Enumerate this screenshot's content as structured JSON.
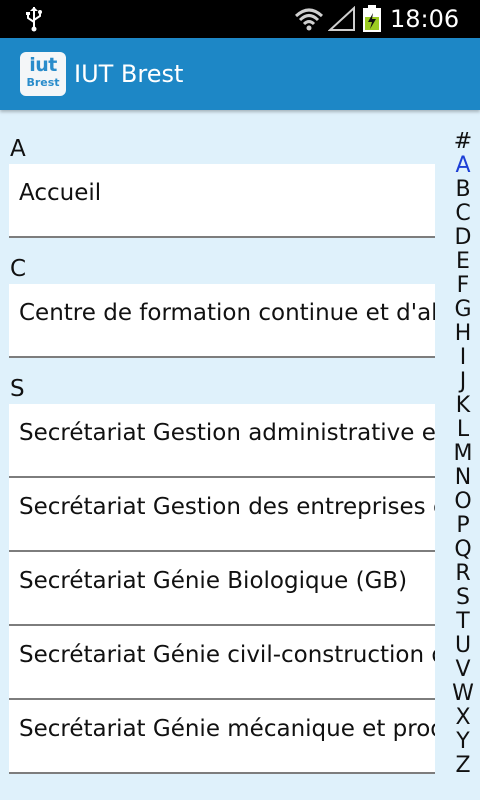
{
  "status_bar": {
    "time": "18:06",
    "icons": [
      "usb-icon",
      "wifi-icon",
      "signal-icon",
      "battery-charging-icon"
    ]
  },
  "action_bar": {
    "logo_top": "iut",
    "logo_bottom": "Brest",
    "title": "IUT Brest"
  },
  "sections": [
    {
      "header": "A",
      "items": [
        "Accueil"
      ]
    },
    {
      "header": "C",
      "items": [
        "Centre de formation continue et d'alternance"
      ]
    },
    {
      "header": "S",
      "items": [
        "Secrétariat Gestion administrative et commerciale",
        "Secrétariat Gestion des entreprises et des administrations",
        "Secrétariat Génie Biologique (GB)",
        "Secrétariat Génie civil-construction durable",
        "Secrétariat Génie mécanique et productique"
      ]
    }
  ],
  "index": {
    "letters": [
      "#",
      "A",
      "B",
      "C",
      "D",
      "E",
      "F",
      "G",
      "H",
      "I",
      "J",
      "K",
      "L",
      "M",
      "N",
      "O",
      "P",
      "Q",
      "R",
      "S",
      "T",
      "U",
      "V",
      "W",
      "X",
      "Y",
      "Z"
    ],
    "active": "A",
    "active_color": "#1d3fd6"
  },
  "colors": {
    "action_bar": "#1d87c6",
    "background": "#dff1fb",
    "status_bar": "#000000"
  }
}
